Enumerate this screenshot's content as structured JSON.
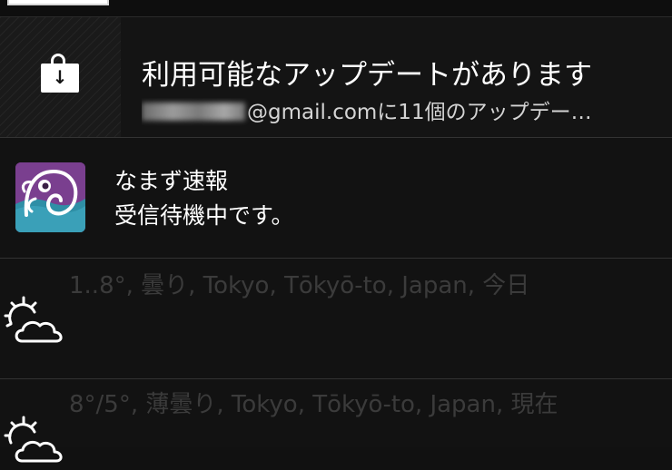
{
  "notifications": {
    "update": {
      "title": "利用可能なアップデートがあります",
      "subtitle": "@gmail.comに11個のアップデー…",
      "icon": "store-bag-download-icon"
    },
    "namazu": {
      "title": "なまず速報",
      "subtitle": "受信待機中です。",
      "icon": "namazu-catfish-app-icon",
      "icon_color": "#7a3f8f"
    },
    "weather": [
      {
        "text": "1..8°, 曇り, Tokyo, Tōkyō-to, Japan, 今日",
        "icon": "partly-cloudy-icon"
      },
      {
        "text": "8°/5°, 薄曇り, Tokyo, Tōkyō-to, Japan, 現在",
        "icon": "partly-cloudy-icon"
      }
    ]
  }
}
